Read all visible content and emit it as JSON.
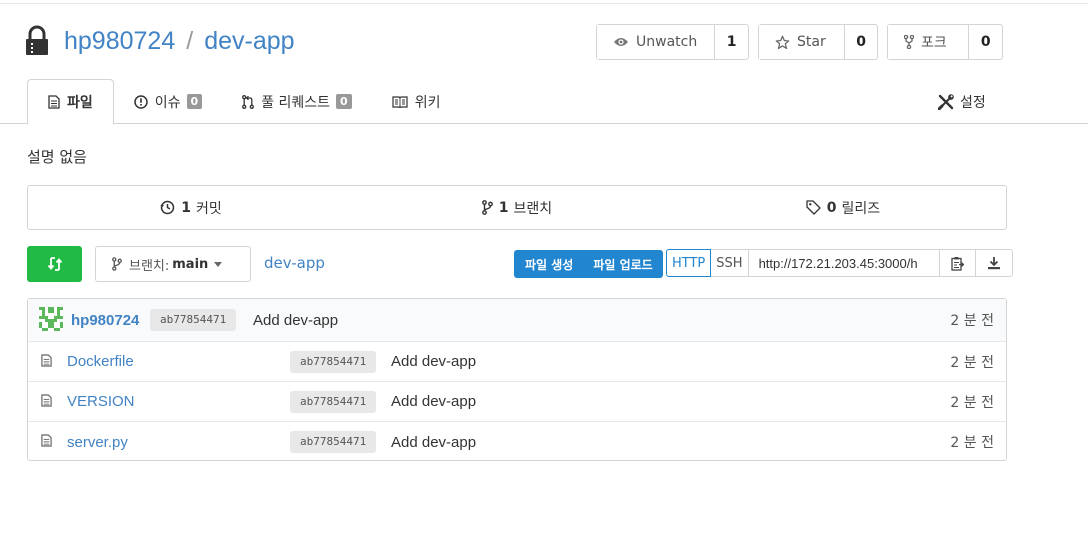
{
  "repo": {
    "owner": "hp980724",
    "separator": "/",
    "name": "dev-app"
  },
  "actions": {
    "watch": {
      "label": "Unwatch",
      "count": "1"
    },
    "star": {
      "label": "Star",
      "count": "0"
    },
    "fork": {
      "label": "포크",
      "count": "0"
    }
  },
  "tabs": [
    {
      "label": "파일",
      "active": true
    },
    {
      "label": "이슈",
      "badge": "0"
    },
    {
      "label": "풀 리퀘스트",
      "badge": "0"
    },
    {
      "label": "위키"
    }
  ],
  "settings_label": "설정",
  "description": "설명 없음",
  "stats": {
    "commits": {
      "count": "1",
      "label": "커밋"
    },
    "branches": {
      "count": "1",
      "label": "브랜치"
    },
    "releases": {
      "count": "0",
      "label": "릴리즈"
    }
  },
  "branch": {
    "prefix": "브랜치:",
    "name": "main"
  },
  "breadcrumb": "dev-app",
  "file_actions": {
    "new_file": "파일 생성",
    "upload": "파일 업로드"
  },
  "clone": {
    "http": "HTTP",
    "ssh": "SSH",
    "url": "http://172.21.203.45:3000/h"
  },
  "last_commit": {
    "author": "hp980724",
    "sha": "ab77854471",
    "message": "Add dev-app",
    "age": "2 분 전"
  },
  "files": [
    {
      "name": "Dockerfile",
      "sha": "ab77854471",
      "message": "Add dev-app",
      "age": "2 분 전"
    },
    {
      "name": "VERSION",
      "sha": "ab77854471",
      "message": "Add dev-app",
      "age": "2 분 전"
    },
    {
      "name": "server.py",
      "sha": "ab77854471",
      "message": "Add dev-app",
      "age": "2 분 전"
    }
  ],
  "colors": {
    "link": "#4183c4",
    "primary": "#2185d0",
    "green": "#21ba45"
  }
}
